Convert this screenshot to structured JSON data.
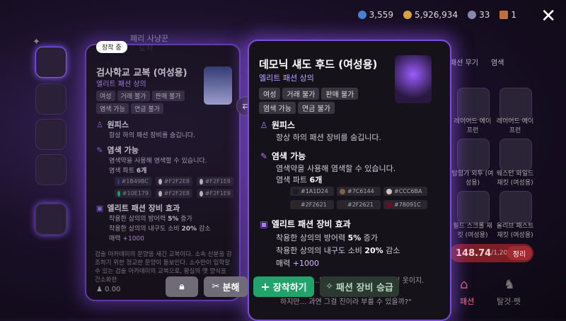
{
  "topbar": {
    "currency1": "3,559",
    "currency2": "5,926,934",
    "currency3": "33",
    "currency4": "1",
    "colors": {
      "c1": "#4a7fd0",
      "c2": "#d8a040",
      "c3": "#8888aa",
      "c4": "#c07040"
    }
  },
  "bg_text": {
    "top_label1": "페리 사냥꾼",
    "top_label2": "도처"
  },
  "right_panel": {
    "tabs": [
      "패션 무기",
      "염색"
    ],
    "items": [
      "레이어드 에이프런",
      "레이어드 에이프런",
      "탐험가 외투 (여성용)",
      "웨스턴 와일드 재킷 (여성용)",
      "필드 스크롤 재킷 (여성용)",
      "올리브 패스트 재킷 (여성용)"
    ],
    "count_label": "148.74",
    "count_total": "/1,200",
    "sort_label": "정리",
    "bottom_tabs": [
      "패션",
      "탈것·펫"
    ]
  },
  "left_card": {
    "badge": "장착 중",
    "title": "검사학교 교복 (여성용)",
    "subtitle": "엘리트 패션 상의",
    "tags": [
      "여성",
      "거래 불가",
      "판매 불가",
      "염색 가능",
      "연금 불가"
    ],
    "sec1_title": "원피스",
    "sec1_text": "항상 하의 패션 장비를 숨깁니다.",
    "sec2_title": "염색 가능",
    "sec2_text": "염색약을 사용해 염색할 수 있습니다.",
    "dye_parts_label": "염색 파트",
    "dye_parts_count": "6개",
    "swatches": [
      {
        "label": "#1B49BC",
        "color": "#1B49BC"
      },
      {
        "label": "#F2F2E8",
        "color": "#F2F2E8"
      },
      {
        "label": "#F2F1E8",
        "color": "#F2F1E8"
      },
      {
        "label": "#10E179",
        "color": "#10E179"
      },
      {
        "label": "#F2F2E8",
        "color": "#F2F2E8"
      },
      {
        "label": "#F2F1E8",
        "color": "#F2F1E8"
      }
    ],
    "sec3_title": "엘리트 패션 장비 효과",
    "sec3_line1_pre": "착용한 상의의 방어력 ",
    "sec3_line1_val": "5%",
    "sec3_line1_post": " 증가",
    "sec3_line2_pre": "착용한 상의의 내구도 소비 ",
    "sec3_line2_val": "20%",
    "sec3_line2_post": " 감소",
    "sec3_line3_pre": "매력 ",
    "sec3_line3_val": "+1000",
    "desc": "검술 아카데미의 문양을 새긴 교복이다. 소속 신분을 강조하기 위한 정교한 문양이 돋보인다. 소수만이 입학할 수 있는 검술 아카데미의 교복으로, 황실의 옛 양식을 간소화한",
    "footer": "0.00"
  },
  "right_card": {
    "title": "데모닉 섀도 후드 (여성용)",
    "subtitle": "엘리트 패션 상의",
    "tags": [
      "여성",
      "거래 불가",
      "판매 불가",
      "염색 가능",
      "연금 불가"
    ],
    "sec1_title": "원피스",
    "sec1_text": "항상 하의 패션 장비를 숨깁니다.",
    "sec2_title": "염색 가능",
    "sec2_text": "염색약을 사용해 염색할 수 있습니다.",
    "dye_parts_label": "염색 파트",
    "dye_parts_count": "6개",
    "swatches": [
      {
        "label": "#1A1D24",
        "color": "#1A1D24"
      },
      {
        "label": "#7C6144",
        "color": "#7C6144"
      },
      {
        "label": "#CCC6BA",
        "color": "#CCC6BA"
      },
      {
        "label": "#2F2621",
        "color": "#2F2621"
      },
      {
        "label": "#2F2621",
        "color": "#2F2621"
      },
      {
        "label": "#78091C",
        "color": "#78091C"
      }
    ],
    "sec3_title": "엘리트 패션 장비 효과",
    "sec3_line1_pre": "착용한 상의의 방어력 ",
    "sec3_line1_val": "5%",
    "sec3_line1_post": " 증가",
    "sec3_line2_pre": "착용한 상의의 내구도 소비 ",
    "sec3_line2_val": "20%",
    "sec3_line2_post": " 감소",
    "sec3_line3_pre": "매력 ",
    "sec3_line3_val": "+1000",
    "desc1": "...만든 섀도 손을 넘는 자들의 옷이지.",
    "desc2": "하지만... 과연 그걸 진이라 부를 수 있을까?\""
  },
  "buttons": {
    "disassemble": "분해",
    "equip": "장착하기",
    "upgrade": "패션 장비 승급"
  }
}
